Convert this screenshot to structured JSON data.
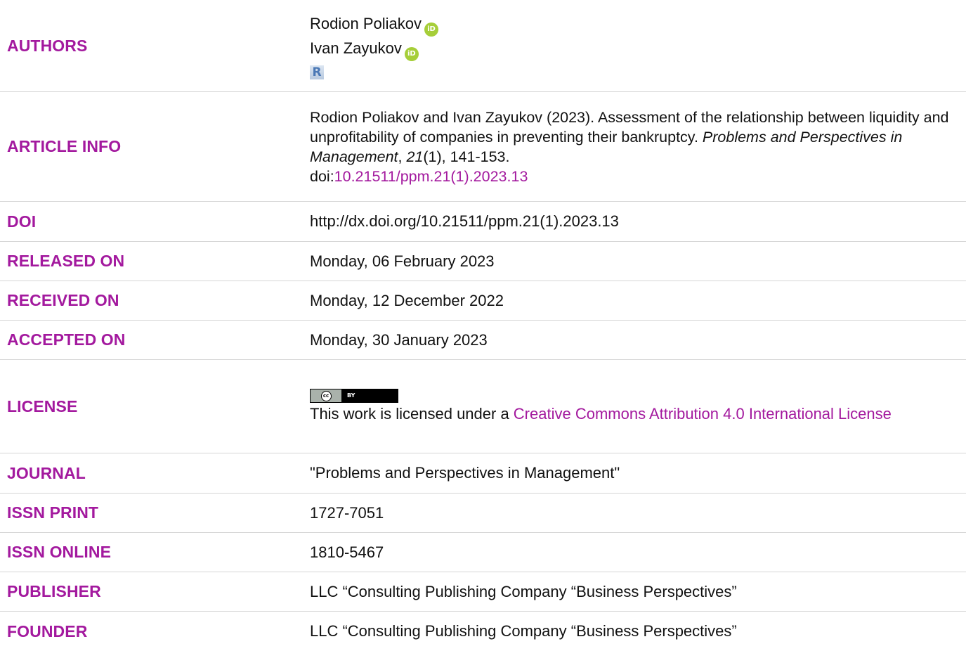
{
  "authors": {
    "label": "AUTHORS",
    "names": [
      "Rodion Poliakov",
      "Ivan Zayukov"
    ],
    "orcid_icon_text": "iD",
    "researchgate_icon_text": "R"
  },
  "article_info": {
    "label": "ARTICLE INFO",
    "citation_prefix": "Rodion Poliakov and Ivan Zayukov (2023). Assessment of the relationship between liquidity and unprofitability of companies in preventing their bankruptcy. ",
    "journal_italic": "Problems and Perspectives in Management",
    "sep1": ", ",
    "volume_italic": "21",
    "issue_pages": "(1), 141-153.",
    "doi_prefix": "doi:",
    "doi_link": "10.21511/ppm.21(1).2023.13"
  },
  "doi": {
    "label": "DOI",
    "value": "http://dx.doi.org/10.21511/ppm.21(1).2023.13"
  },
  "released_on": {
    "label": "RELEASED ON",
    "value": "Monday, 06 February 2023"
  },
  "received_on": {
    "label": "RECEIVED ON",
    "value": "Monday, 12 December 2022"
  },
  "accepted_on": {
    "label": "ACCEPTED ON",
    "value": "Monday, 30 January 2023"
  },
  "license": {
    "label": "LICENSE",
    "badge_cc": "cc",
    "badge_by": "BY",
    "text_prefix": "This work is licensed under a ",
    "link_text": "Creative Commons Attribution 4.0 International License"
  },
  "journal": {
    "label": "JOURNAL",
    "value": "\"Problems and Perspectives in Management\""
  },
  "issn_print": {
    "label": "ISSN PRINT",
    "value": "1727-7051"
  },
  "issn_online": {
    "label": "ISSN ONLINE",
    "value": "1810-5467"
  },
  "publisher": {
    "label": "PUBLISHER",
    "value": "LLC “Consulting Publishing Company “Business Perspectives”"
  },
  "founder": {
    "label": "FOUNDER",
    "value": "LLC “Consulting Publishing Company “Business Perspectives”"
  },
  "colors": {
    "accent": "#a3199e",
    "orcid": "#a6ce39",
    "divider": "#d6d6d6"
  }
}
